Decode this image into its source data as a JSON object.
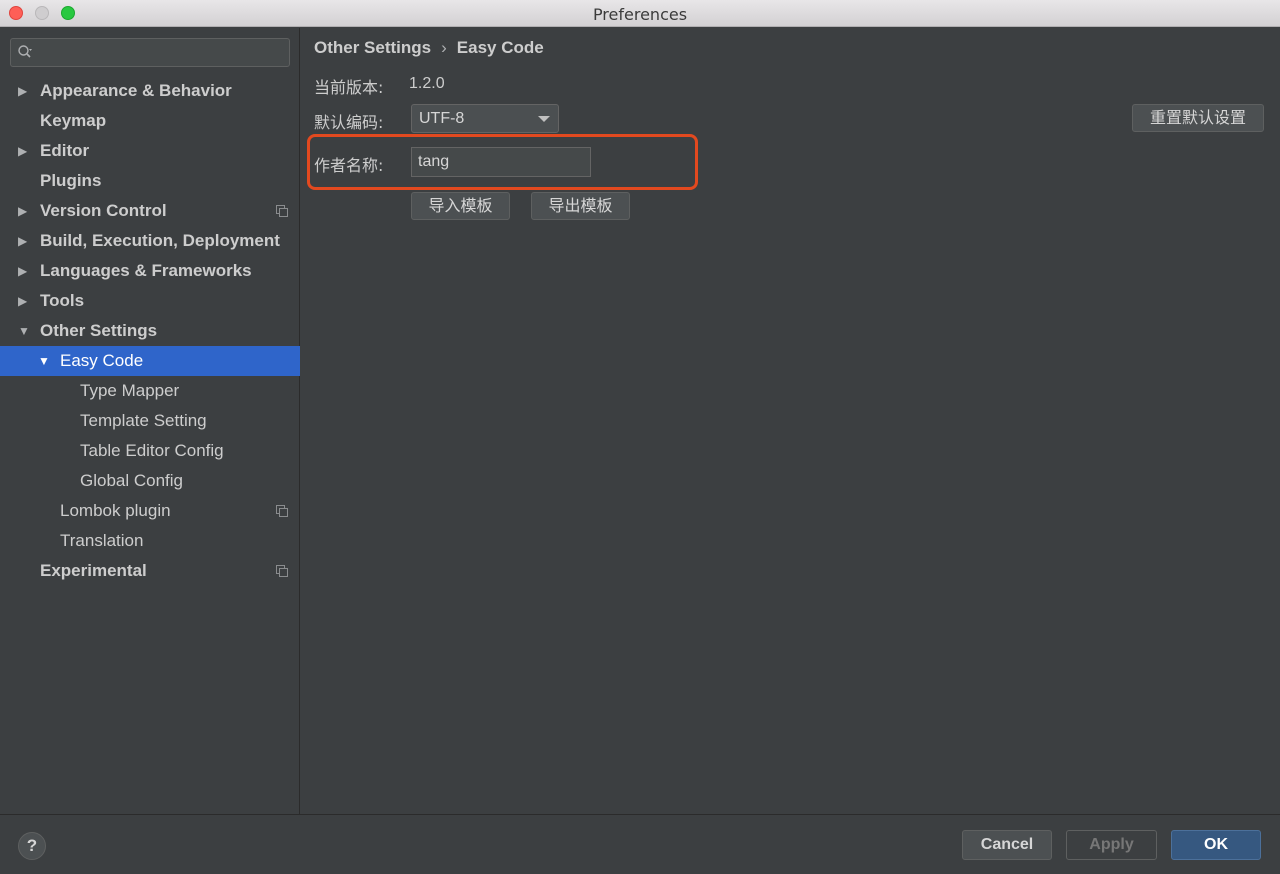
{
  "window": {
    "title": "Preferences"
  },
  "search": {
    "placeholder": ""
  },
  "sidebar": {
    "items": [
      {
        "label": "Appearance & Behavior",
        "expandable": true,
        "expanded": false,
        "bold": true,
        "level": 0
      },
      {
        "label": "Keymap",
        "expandable": false,
        "bold": true,
        "level": 0
      },
      {
        "label": "Editor",
        "expandable": true,
        "expanded": false,
        "bold": true,
        "level": 0
      },
      {
        "label": "Plugins",
        "expandable": false,
        "bold": true,
        "level": 0
      },
      {
        "label": "Version Control",
        "expandable": true,
        "expanded": false,
        "bold": true,
        "level": 0,
        "project_icon": true
      },
      {
        "label": "Build, Execution, Deployment",
        "expandable": true,
        "expanded": false,
        "bold": true,
        "level": 0
      },
      {
        "label": "Languages & Frameworks",
        "expandable": true,
        "expanded": false,
        "bold": true,
        "level": 0
      },
      {
        "label": "Tools",
        "expandable": true,
        "expanded": false,
        "bold": true,
        "level": 0
      },
      {
        "label": "Other Settings",
        "expandable": true,
        "expanded": true,
        "bold": true,
        "level": 0
      },
      {
        "label": "Easy Code",
        "expandable": true,
        "expanded": true,
        "bold": false,
        "level": 1,
        "selected": true
      },
      {
        "label": "Type Mapper",
        "expandable": false,
        "bold": false,
        "level": 2
      },
      {
        "label": "Template Setting",
        "expandable": false,
        "bold": false,
        "level": 2
      },
      {
        "label": "Table Editor Config",
        "expandable": false,
        "bold": false,
        "level": 2
      },
      {
        "label": "Global Config",
        "expandable": false,
        "bold": false,
        "level": 2
      },
      {
        "label": "Lombok plugin",
        "expandable": false,
        "bold": false,
        "level": 1,
        "project_icon": true
      },
      {
        "label": "Translation",
        "expandable": false,
        "bold": false,
        "level": 1
      },
      {
        "label": "Experimental",
        "expandable": false,
        "bold": true,
        "level": 0,
        "project_icon": true
      }
    ]
  },
  "breadcrumb": {
    "parent": "Other Settings",
    "separator": "›",
    "current": "Easy Code"
  },
  "form": {
    "version_label": "当前版本:",
    "version_value": "1.2.0",
    "encoding_label": "默认编码:",
    "encoding_value": "UTF-8",
    "author_label": "作者名称:",
    "author_value": "tang",
    "import_button": "导入模板",
    "export_button": "导出模板",
    "reset_button": "重置默认设置"
  },
  "footer": {
    "help": "?",
    "cancel": "Cancel",
    "apply": "Apply",
    "ok": "OK"
  },
  "colors": {
    "selection": "#2f65ca",
    "highlight_box": "#e2491f",
    "ok_button": "#365880"
  }
}
